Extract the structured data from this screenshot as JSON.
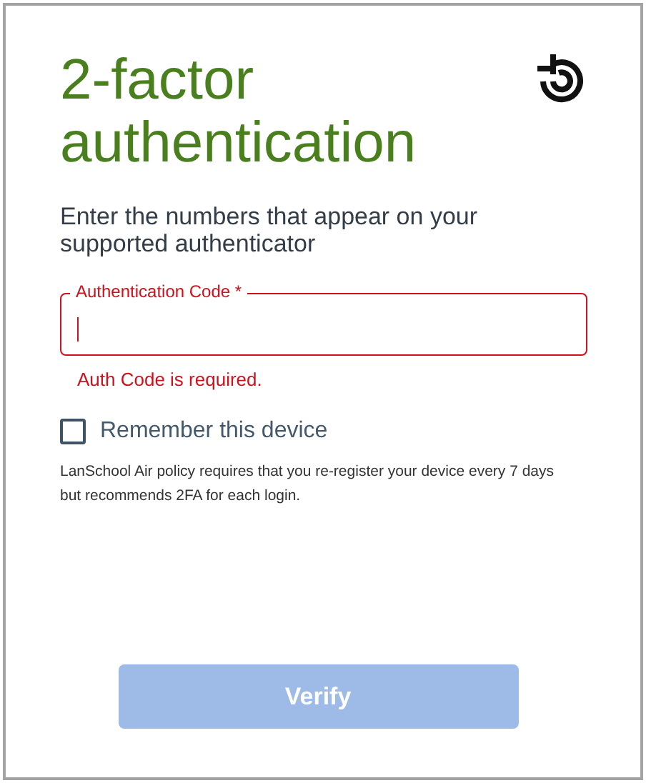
{
  "title": "2-factor authentication",
  "subtitle": "Enter the numbers that appear on your supported authenticator",
  "code_field": {
    "label": "Authentication Code *",
    "error": true,
    "focused": true,
    "error_message": "Auth Code is required."
  },
  "remember": {
    "label": "Remember this device",
    "checked": false
  },
  "policy_note": "LanSchool Air policy requires that you re-register your device every 7 days but recommends 2FA for each login.",
  "verify_button": {
    "label": "Verify",
    "disabled": true
  }
}
